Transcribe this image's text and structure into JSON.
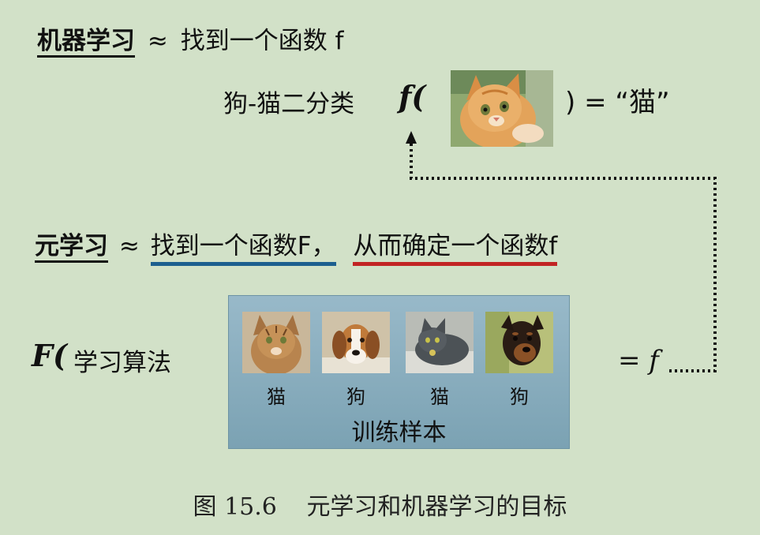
{
  "ml": {
    "term": "机器学习",
    "approx": "≈",
    "desc": "找到一个函数 f"
  },
  "binary": {
    "label": "狗-猫二分类",
    "f_open": "f(",
    "f_close": ") = “猫”"
  },
  "meta": {
    "term": "元学习",
    "approx": "≈",
    "part1": "找到一个函数F，",
    "part2": "从而确定一个函数f"
  },
  "algo": {
    "F_open": "F(",
    "label": "学习算法"
  },
  "samples": {
    "title": "训练样本",
    "items": [
      {
        "label": "猫",
        "kind": "cat-tabby"
      },
      {
        "label": "狗",
        "kind": "dog-beagle"
      },
      {
        "label": "猫",
        "kind": "cat-gray"
      },
      {
        "label": "狗",
        "kind": "dog-black"
      }
    ]
  },
  "result": {
    "eq": "= f"
  },
  "caption": {
    "number": "图 15.6",
    "text": "元学习和机器学习的目标"
  },
  "colors": {
    "background": "#d2e1c8",
    "box": "#86aabb",
    "underline_blue": "#1d5f8f",
    "underline_red": "#c22424"
  }
}
